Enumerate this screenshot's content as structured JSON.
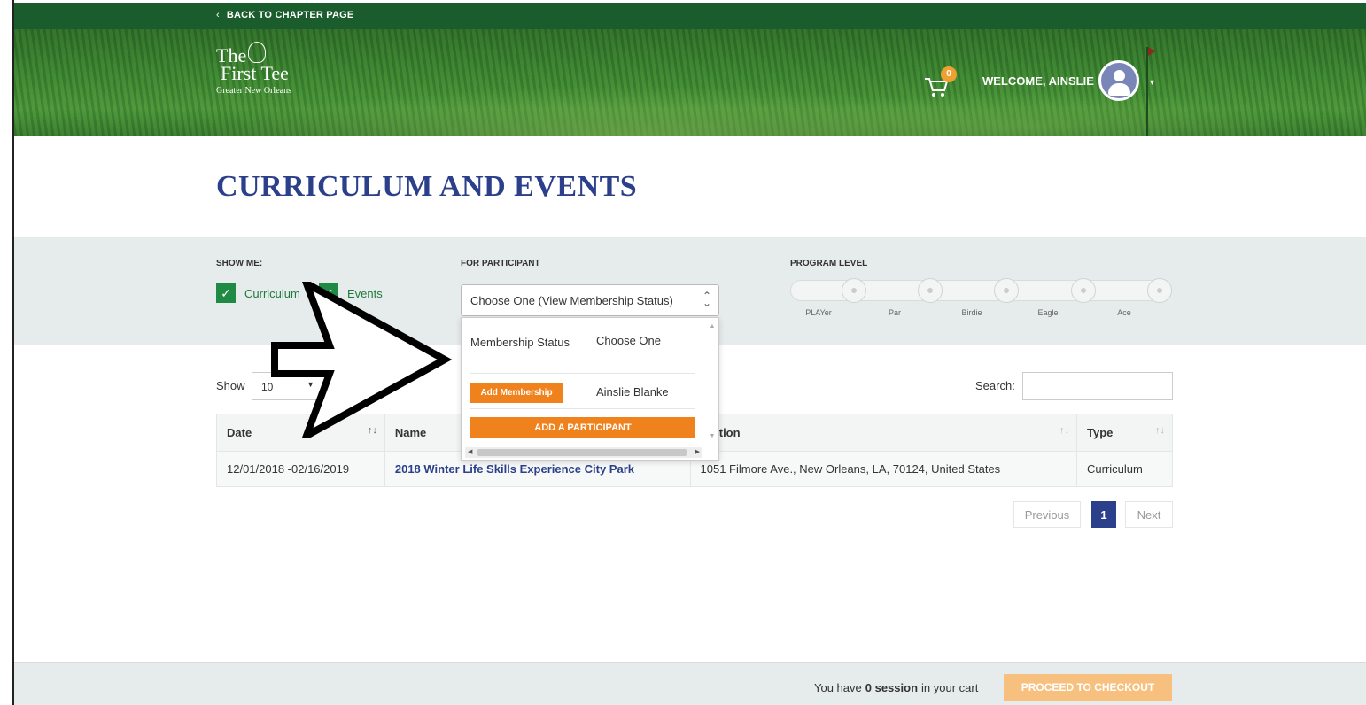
{
  "topbar": {
    "back_label": "BACK TO CHAPTER PAGE"
  },
  "header": {
    "logo_line1": "The",
    "logo_line2": "First Tee",
    "logo_line3": "Greater New Orleans",
    "cart_count": "0",
    "welcome": "WELCOME, AINSLIE"
  },
  "page_title": "CURRICULUM AND EVENTS",
  "filters": {
    "show_me_label": "SHOW ME:",
    "curriculum_label": "Curriculum",
    "events_label": "Events",
    "participant_label": "FOR PARTICIPANT",
    "participant_value": "Choose One (View Membership Status)",
    "program_level_label": "PROGRAM LEVEL",
    "levels": [
      "PLAYer",
      "Par",
      "Birdie",
      "Eagle",
      "Ace"
    ]
  },
  "dropdown": {
    "membership_status_label": "Membership Status",
    "choose_one": "Choose One",
    "add_membership": "Add Membership",
    "participant_name": "Ainslie Blanke",
    "add_participant": "ADD A PARTICIPANT"
  },
  "table_controls": {
    "show_label": "Show",
    "show_value": "10",
    "search_label": "Search:"
  },
  "table": {
    "headers": [
      "Date",
      "Name",
      "Location",
      "Type"
    ],
    "location_header_visible": "ation",
    "rows": [
      {
        "date": "12/01/2018 -02/16/2019",
        "name": "2018 Winter Life Skills Experience City Park",
        "location": "1051 Filmore Ave., New Orleans, LA, 70124, United States",
        "type": "Curriculum"
      }
    ]
  },
  "pagination": {
    "previous": "Previous",
    "current": "1",
    "next": "Next"
  },
  "footer": {
    "cart_prefix": "You have",
    "cart_count": "0 session",
    "cart_suffix": "in your cart",
    "checkout": "PROCEED TO CHECKOUT"
  },
  "colors": {
    "brand_green": "#1a5c2c",
    "title_blue": "#2b3f8a",
    "accent_orange": "#f0821e",
    "check_green": "#1f8a44"
  }
}
